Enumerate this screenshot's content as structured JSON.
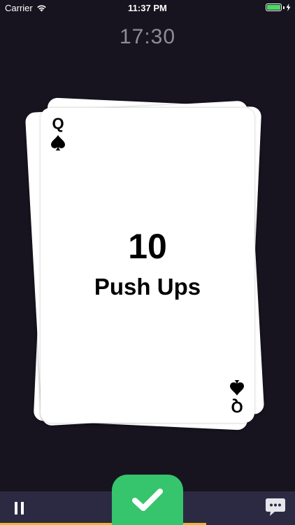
{
  "status_bar": {
    "carrier": "Carrier",
    "time": "11:37 PM",
    "battery_color": "#4cd964"
  },
  "timer": "17:30",
  "card": {
    "rank": "Q",
    "suit": "spade-icon",
    "reps": "10",
    "exercise": "Push Ups"
  },
  "controls": {
    "pause_icon": "pause-icon",
    "complete_icon": "checkmark-icon",
    "chat_icon": "chat-bubble-icon",
    "progress_fraction": 0.7
  },
  "colors": {
    "background": "#17141f",
    "bottom_bar": "#2c2a43",
    "complete_button": "#36c46d",
    "progress": "#f0b531",
    "timer_text": "#8e8d94"
  }
}
